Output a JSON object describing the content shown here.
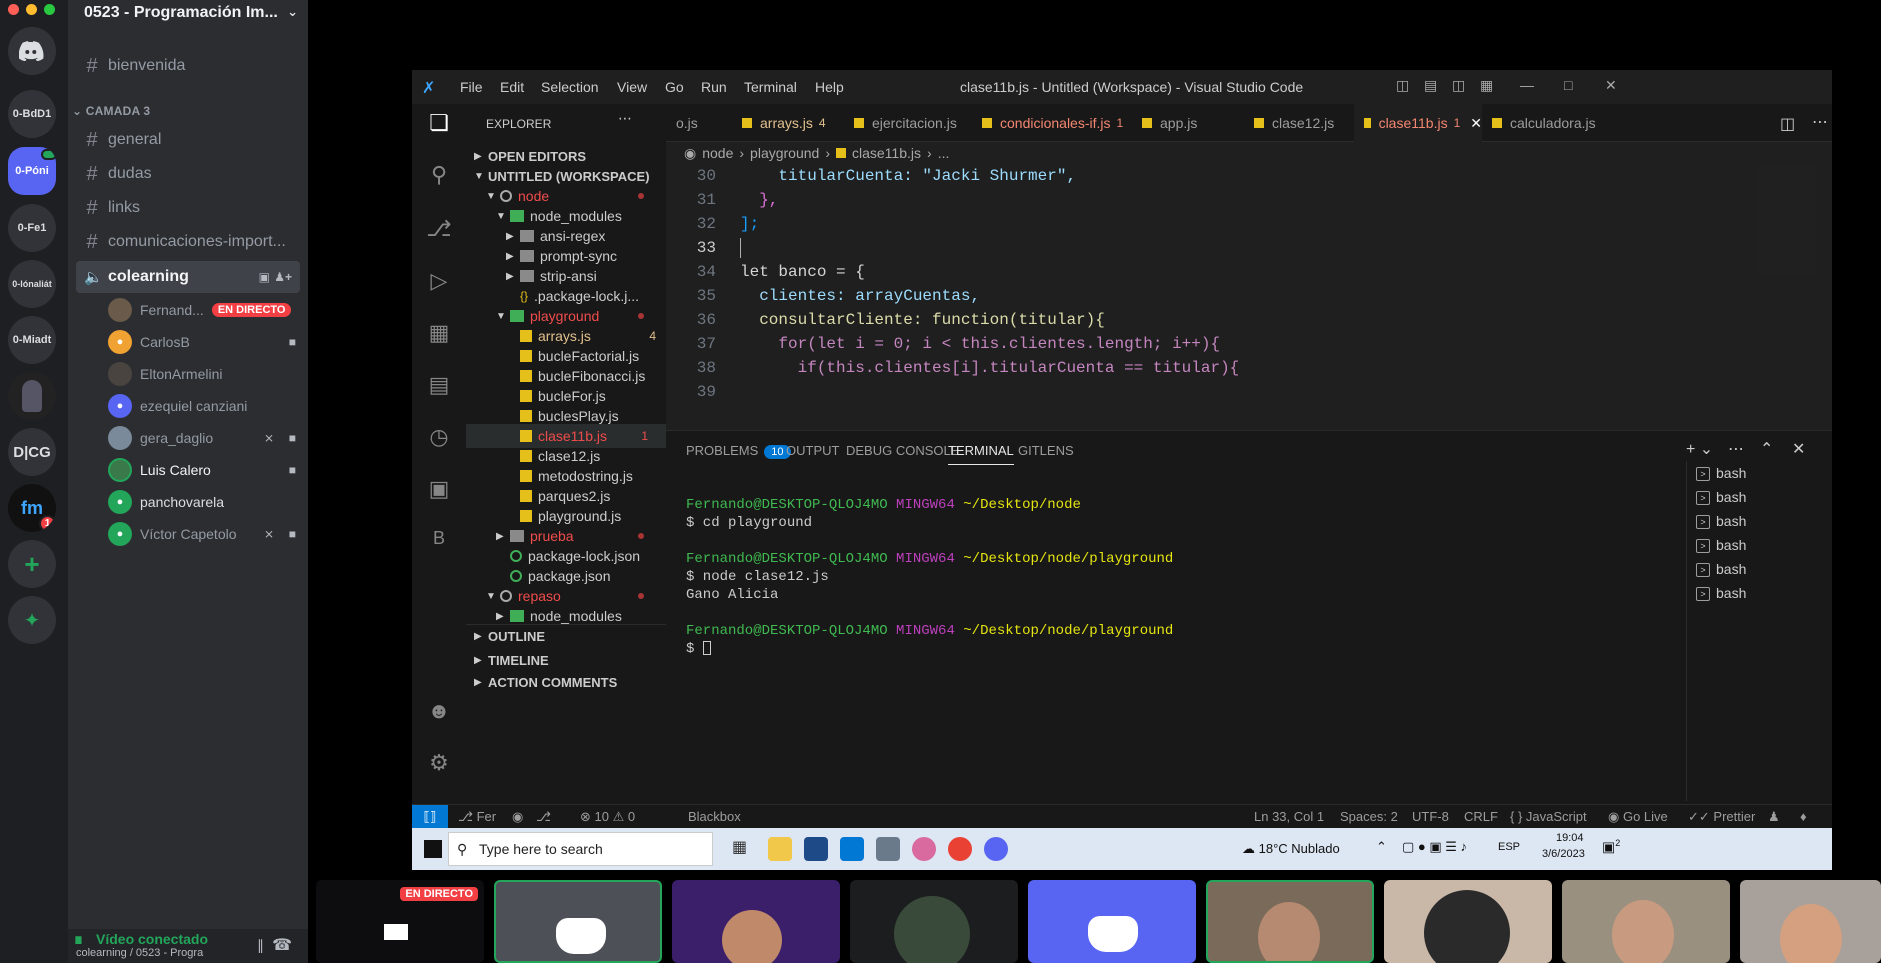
{
  "discord": {
    "server_name": "0523 - Programación Im...",
    "servers": [
      "0-BdD1",
      "0-Póni",
      "0-Fe1",
      "0-lónaliát",
      "0-Miadt",
      "D|CG"
    ],
    "server_badge": "1",
    "channels_top": [
      {
        "label": "bienvenida"
      }
    ],
    "category": "CAMADA 3",
    "channels": [
      {
        "label": "general"
      },
      {
        "label": "dudas"
      },
      {
        "label": "links"
      },
      {
        "label": "comunicaciones-import..."
      }
    ],
    "voice_channel": "colearning",
    "voice_users": [
      {
        "name": "Fernand...",
        "live": "EN DIRECTO"
      },
      {
        "name": "CarlosB"
      },
      {
        "name": "EltonArmelini"
      },
      {
        "name": "ezequiel canziani"
      },
      {
        "name": "gera_daglio"
      },
      {
        "name": "Luis Calero"
      },
      {
        "name": "panchovarela"
      },
      {
        "name": "Víctor Capetolo"
      }
    ],
    "voice_status": "Vídeo conectado",
    "voice_sub": "colearning / 0523 - Progra"
  },
  "vscode": {
    "menu": [
      "File",
      "Edit",
      "Selection",
      "View",
      "Go",
      "Run",
      "Terminal",
      "Help"
    ],
    "title": "clase11b.js - Untitled (Workspace) - Visual Studio Code",
    "explorer_header": "EXPLORER",
    "sections": {
      "open_editors": "OPEN EDITORS",
      "workspace": "UNTITLED (WORKSPACE)",
      "outline": "OUTLINE",
      "timeline": "TIMELINE",
      "action_comments": "ACTION COMMENTS"
    },
    "tree": [
      {
        "label": "node"
      },
      {
        "label": "node_modules"
      },
      {
        "label": "ansi-regex"
      },
      {
        "label": "prompt-sync"
      },
      {
        "label": "strip-ansi"
      },
      {
        "label": ".package-lock.j..."
      },
      {
        "label": "playground"
      },
      {
        "label": "arrays.js",
        "count": "4"
      },
      {
        "label": "bucleFactorial.js"
      },
      {
        "label": "bucleFibonacci.js"
      },
      {
        "label": "bucleFor.js"
      },
      {
        "label": "buclesPlay.js"
      },
      {
        "label": "clase11b.js",
        "count": "1"
      },
      {
        "label": "clase12.js"
      },
      {
        "label": "metodostring.js"
      },
      {
        "label": "parques2.js"
      },
      {
        "label": "playground.js"
      },
      {
        "label": "prueba"
      },
      {
        "label": "package-lock.json"
      },
      {
        "label": "package.json"
      },
      {
        "label": "repaso"
      },
      {
        "label": "node_modules"
      }
    ],
    "tabs": [
      {
        "label": "o.js"
      },
      {
        "label": "arrays.js",
        "err": "4"
      },
      {
        "label": "ejercitacion.js"
      },
      {
        "label": "condicionales-if.js",
        "err": "1"
      },
      {
        "label": "app.js"
      },
      {
        "label": "clase12.js"
      },
      {
        "label": "clase11b.js",
        "err": "1"
      },
      {
        "label": "calculadora.js"
      }
    ],
    "breadcrumb": [
      "node",
      "playground",
      "clase11b.js",
      "..."
    ],
    "code": [
      {
        "n": "30",
        "t": "    titularCuenta: \"Jacki Shurmer\","
      },
      {
        "n": "31",
        "t": "  },"
      },
      {
        "n": "32",
        "t": "];"
      },
      {
        "n": "33",
        "t": ""
      },
      {
        "n": "34",
        "t": "let banco = {"
      },
      {
        "n": "35",
        "t": "  clientes: arrayCuentas,"
      },
      {
        "n": "36",
        "t": "  consultarCliente: function(titular){"
      },
      {
        "n": "37",
        "t": "    for(let i = 0; i < this.clientes.length; i++){"
      },
      {
        "n": "38",
        "t": "      if(this.clientes[i].titularCuenta == titular){"
      },
      {
        "n": "39",
        "t": ""
      }
    ],
    "panel_tabs": [
      {
        "label": "PROBLEMS",
        "badge": "10"
      },
      {
        "label": "OUTPUT"
      },
      {
        "label": "DEBUG CONSOLE"
      },
      {
        "label": "TERMINAL"
      },
      {
        "label": "GITLENS"
      }
    ],
    "terminal": [
      {
        "user": "Fernando@DESKTOP-QLOJ4MO",
        "sys": "MINGW64",
        "path": "~/Desktop/node"
      },
      {
        "cmd": "$ cd playground"
      },
      {
        "user": "Fernando@DESKTOP-QLOJ4MO",
        "sys": "MINGW64",
        "path": "~/Desktop/node/playground"
      },
      {
        "cmd": "$ node clase12.js"
      },
      {
        "out": "Gano Alicia"
      },
      {
        "user": "Fernando@DESKTOP-QLOJ4MO",
        "sys": "MINGW64",
        "path": "~/Desktop/node/playground"
      },
      {
        "cmd": "$ "
      }
    ],
    "bash_list": [
      "bash",
      "bash",
      "bash",
      "bash",
      "bash",
      "bash"
    ],
    "status": {
      "branch": "Fer",
      "errors": "10",
      "warnings": "0",
      "blackbox": "Blackbox",
      "position": "Ln 33, Col 1",
      "spaces": "Spaces: 2",
      "encoding": "UTF-8",
      "eol": "CRLF",
      "language": "JavaScript",
      "golive": "Go Live",
      "prettier": "Prettier"
    }
  },
  "taskbar": {
    "search_placeholder": "Type here to search",
    "weather": "18°C  Nublado",
    "lang": "ESP",
    "time": "19:04",
    "date": "3/6/2023",
    "notif": "2"
  },
  "participants": {
    "live_tag": "EN DIRECTO"
  }
}
